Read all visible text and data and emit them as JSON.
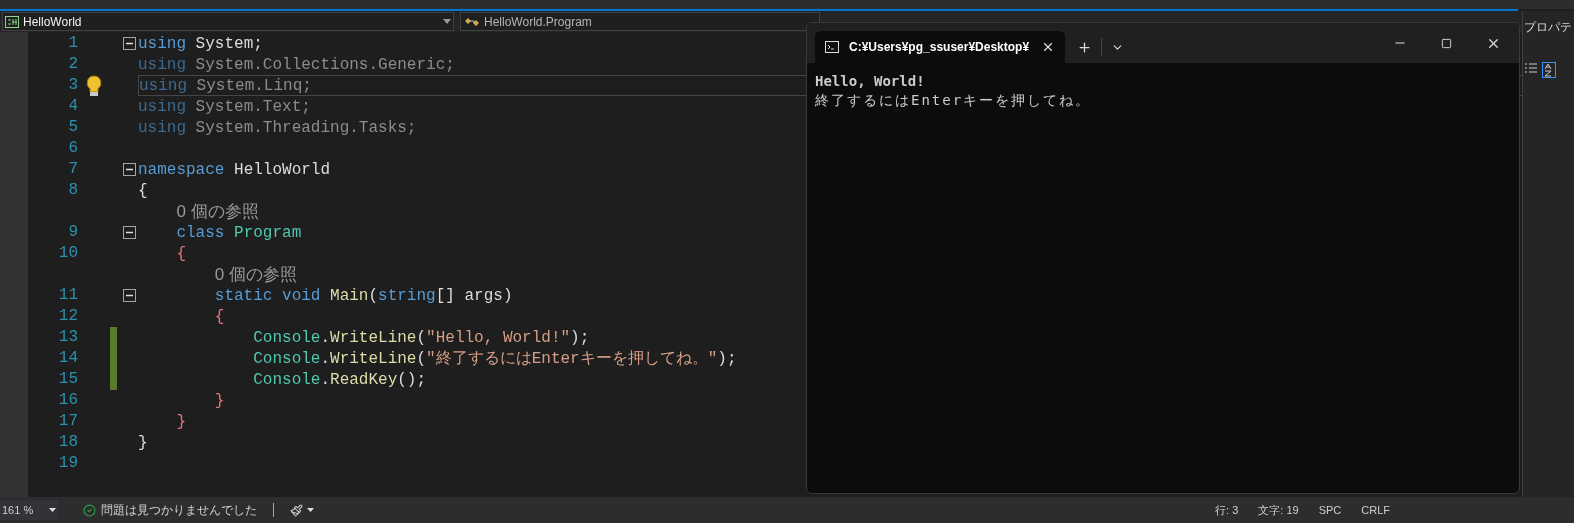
{
  "navigation": {
    "project": "HelloWorld",
    "class": "HelloWorld.Program"
  },
  "editor": {
    "rows": [
      {
        "kind": "code",
        "number": "1",
        "fold": true,
        "current": false,
        "changed": false,
        "tokens": [
          {
            "kind": "keyword",
            "text": "using"
          },
          {
            "kind": "plain",
            "text": " System;"
          }
        ]
      },
      {
        "kind": "code",
        "number": "2",
        "fold": false,
        "current": false,
        "changed": false,
        "tokens": [
          {
            "kind": "faded_keyword",
            "text": "using"
          },
          {
            "kind": "faded_plain",
            "text": " System.Collections.Generic;"
          }
        ]
      },
      {
        "kind": "code",
        "number": "3",
        "fold": false,
        "current": true,
        "changed": false,
        "tokens": [
          {
            "kind": "faded_keyword",
            "text": "using"
          },
          {
            "kind": "faded_plain",
            "text": " System.Linq;"
          }
        ]
      },
      {
        "kind": "code",
        "number": "4",
        "fold": false,
        "current": false,
        "changed": false,
        "tokens": [
          {
            "kind": "faded_keyword",
            "text": "using"
          },
          {
            "kind": "faded_plain",
            "text": " System.Text;"
          }
        ]
      },
      {
        "kind": "code",
        "number": "5",
        "fold": false,
        "current": false,
        "changed": false,
        "tokens": [
          {
            "kind": "faded_keyword",
            "text": "using"
          },
          {
            "kind": "faded_plain",
            "text": " System.Threading.Tasks;"
          }
        ]
      },
      {
        "kind": "code",
        "number": "6",
        "fold": false,
        "current": false,
        "changed": false,
        "tokens": []
      },
      {
        "kind": "code",
        "number": "7",
        "fold": true,
        "current": false,
        "changed": false,
        "tokens": [
          {
            "kind": "keyword",
            "text": "namespace"
          },
          {
            "kind": "plain",
            "text": " HelloWorld"
          }
        ]
      },
      {
        "kind": "code",
        "number": "8",
        "fold": false,
        "current": false,
        "changed": false,
        "tokens": [
          {
            "kind": "plain",
            "text": "{"
          }
        ]
      },
      {
        "kind": "lens",
        "text": "    0 個の参照"
      },
      {
        "kind": "code",
        "number": "9",
        "fold": true,
        "current": false,
        "changed": false,
        "tokens": [
          {
            "kind": "keyword",
            "text": "    class"
          },
          {
            "kind": "type",
            "text": " Program"
          }
        ]
      },
      {
        "kind": "code",
        "number": "10",
        "fold": false,
        "current": false,
        "changed": false,
        "tokens": [
          {
            "kind": "brace",
            "text": "    {"
          }
        ]
      },
      {
        "kind": "lens",
        "text": "        0 個の参照"
      },
      {
        "kind": "code",
        "number": "11",
        "fold": true,
        "current": false,
        "changed": false,
        "tokens": [
          {
            "kind": "keyword",
            "text": "        static void"
          },
          {
            "kind": "method",
            "text": " Main"
          },
          {
            "kind": "plain",
            "text": "("
          },
          {
            "kind": "keyword",
            "text": "string"
          },
          {
            "kind": "plain",
            "text": "[] args)"
          }
        ]
      },
      {
        "kind": "code",
        "number": "12",
        "fold": false,
        "current": false,
        "changed": false,
        "tokens": [
          {
            "kind": "brace",
            "text": "        {"
          }
        ]
      },
      {
        "kind": "code",
        "number": "13",
        "fold": false,
        "current": false,
        "changed": true,
        "tokens": [
          {
            "kind": "type",
            "text": "            Console"
          },
          {
            "kind": "plain",
            "text": "."
          },
          {
            "kind": "method",
            "text": "WriteLine"
          },
          {
            "kind": "plain",
            "text": "("
          },
          {
            "kind": "string",
            "text": "\"Hello, World!\""
          },
          {
            "kind": "plain",
            "text": ");"
          }
        ]
      },
      {
        "kind": "code",
        "number": "14",
        "fold": false,
        "current": false,
        "changed": true,
        "tokens": [
          {
            "kind": "type",
            "text": "            Console"
          },
          {
            "kind": "plain",
            "text": "."
          },
          {
            "kind": "method",
            "text": "WriteLine"
          },
          {
            "kind": "plain",
            "text": "("
          },
          {
            "kind": "string",
            "text": "\"終了するにはEnterキーを押してね。\""
          },
          {
            "kind": "plain",
            "text": ");"
          }
        ]
      },
      {
        "kind": "code",
        "number": "15",
        "fold": false,
        "current": false,
        "changed": true,
        "tokens": [
          {
            "kind": "type",
            "text": "            Console"
          },
          {
            "kind": "plain",
            "text": "."
          },
          {
            "kind": "method",
            "text": "ReadKey"
          },
          {
            "kind": "plain",
            "text": "();"
          }
        ]
      },
      {
        "kind": "code",
        "number": "16",
        "fold": false,
        "current": false,
        "changed": false,
        "tokens": [
          {
            "kind": "brace",
            "text": "        }"
          }
        ]
      },
      {
        "kind": "code",
        "number": "17",
        "fold": false,
        "current": false,
        "changed": false,
        "tokens": [
          {
            "kind": "brace",
            "text": "    }"
          }
        ]
      },
      {
        "kind": "code",
        "number": "18",
        "fold": false,
        "current": false,
        "changed": false,
        "tokens": [
          {
            "kind": "plain",
            "text": "}"
          }
        ]
      },
      {
        "kind": "code",
        "number": "19",
        "fold": false,
        "current": false,
        "changed": false,
        "tokens": []
      }
    ]
  },
  "side_panel": {
    "title": "プロパテ"
  },
  "terminal": {
    "tab_title": "C:¥Users¥pg_ssuser¥Desktop¥",
    "lines": [
      {
        "kind": "bold",
        "text": "Hello, World!"
      },
      {
        "kind": "normal",
        "text": "終了するにはEnterキーを押してね。"
      }
    ]
  },
  "status_bar": {
    "zoom": "161 %",
    "issues": "問題は見つかりませんでした",
    "position": [
      "行: 3",
      "文字: 19",
      "SPC",
      "CRLF"
    ]
  }
}
